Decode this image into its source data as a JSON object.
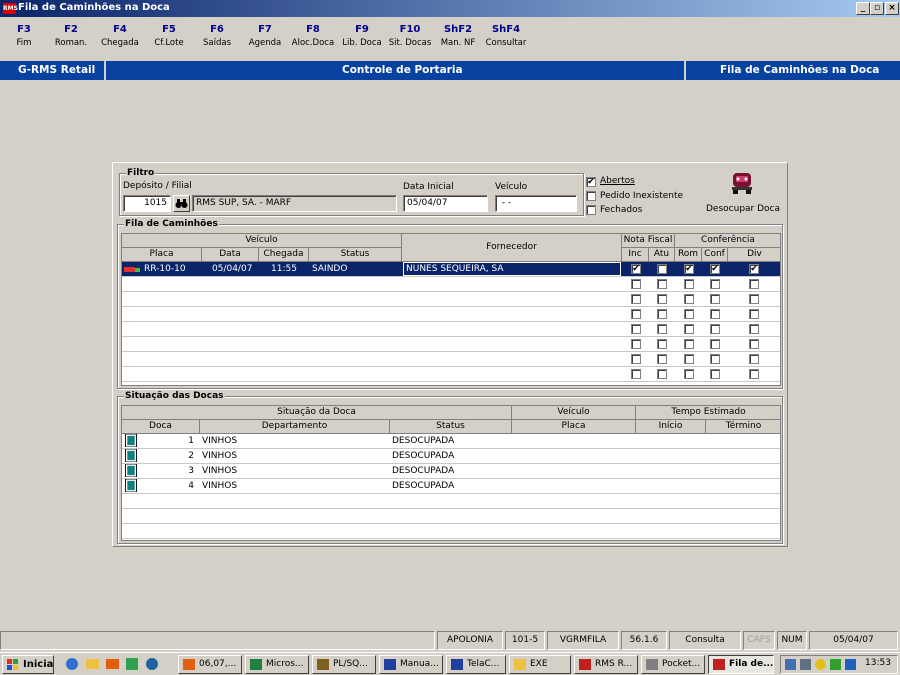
{
  "window": {
    "title": "Fila de Caminhões na Doca",
    "icon_text": "RMS",
    "buttons": [
      "_",
      "▫",
      "×"
    ]
  },
  "fkeys": [
    {
      "key": "F3",
      "label": "Fim"
    },
    {
      "key": "F2",
      "label": "Roman."
    },
    {
      "key": "F4",
      "label": "Chegada"
    },
    {
      "key": "F5",
      "label": "Cf.Lote"
    },
    {
      "key": "F6",
      "label": "Saídas"
    },
    {
      "key": "F7",
      "label": "Agenda"
    },
    {
      "key": "F8",
      "label": "Aloc.Doca"
    },
    {
      "key": "F9",
      "label": "Lib. Doca"
    },
    {
      "key": "F10",
      "label": "Sit. Docas"
    },
    {
      "key": "ShF2",
      "label": "Man. NF"
    },
    {
      "key": "ShF4",
      "label": "Consultar"
    }
  ],
  "header": {
    "left": "G-RMS Retail",
    "center": "Controle de Portaria",
    "right": "Fila de Caminhões na Doca"
  },
  "filtro": {
    "title": "Filtro",
    "deposito_label": "Depósito / Filial",
    "deposito_code": "1015",
    "deposito_name": "RMS SUP, SA. - MARF",
    "data_label": "Data Inicial",
    "data_value": "05/04/07",
    "veiculo_label": "Veículo",
    "veiculo_value": " - -",
    "abertos": "Abertos",
    "pedido": "Pedido Inexistente",
    "fechados": "Fechados",
    "desocupar": "Desocupar Doca"
  },
  "fila": {
    "title": "Fila de Caminhões",
    "group_veiculo": "Veículo",
    "group_nota": "Nota Fiscal",
    "group_conf": "Conferência",
    "cols": {
      "placa": "Placa",
      "data": "Data",
      "chegada": "Chegada",
      "status": "Status",
      "fornecedor": "Fornecedor",
      "inc": "Inc",
      "atu": "Atu",
      "rom": "Rom",
      "conf": "Conf",
      "div": "Div"
    },
    "rows": [
      {
        "placa": "RR-10-10",
        "data": "05/04/07",
        "chegada": "11:55",
        "status": "SAINDO",
        "fornecedor": "NUNES SEQUEIRA, SA",
        "inc": true,
        "atu": false,
        "rom": true,
        "conf": true,
        "div": true
      }
    ],
    "empty_rows": 7
  },
  "docas": {
    "title": "Situação das Docas",
    "group_situacao": "Situação da Doca",
    "group_veiculo": "Veículo",
    "group_tempo": "Tempo Estimado",
    "cols": {
      "doca": "Doca",
      "departamento": "Departamento",
      "status": "Status",
      "placa": "Placa",
      "inicio": "Início",
      "termino": "Término"
    },
    "rows": [
      {
        "doca": "1",
        "departamento": "VINHOS",
        "status": "DESOCUPADA"
      },
      {
        "doca": "2",
        "departamento": "VINHOS",
        "status": "DESOCUPADA"
      },
      {
        "doca": "3",
        "departamento": "VINHOS",
        "status": "DESOCUPADA"
      },
      {
        "doca": "4",
        "departamento": "VINHOS",
        "status": "DESOCUPADA"
      }
    ]
  },
  "statusbar": [
    "APOLONIA",
    "101-5",
    "VGRMFILA",
    "56.1.6",
    "Consulta",
    "CAPS",
    "NUM",
    "05/04/07"
  ],
  "taskbar": {
    "start": "Iniciar",
    "items": [
      "06,07,...",
      "Micros...",
      "PL/SQ...",
      "Manua...",
      "TelaC...",
      "EXE",
      "RMS R...",
      "Pocket...",
      "Fila de..."
    ],
    "clock": "13:53"
  }
}
